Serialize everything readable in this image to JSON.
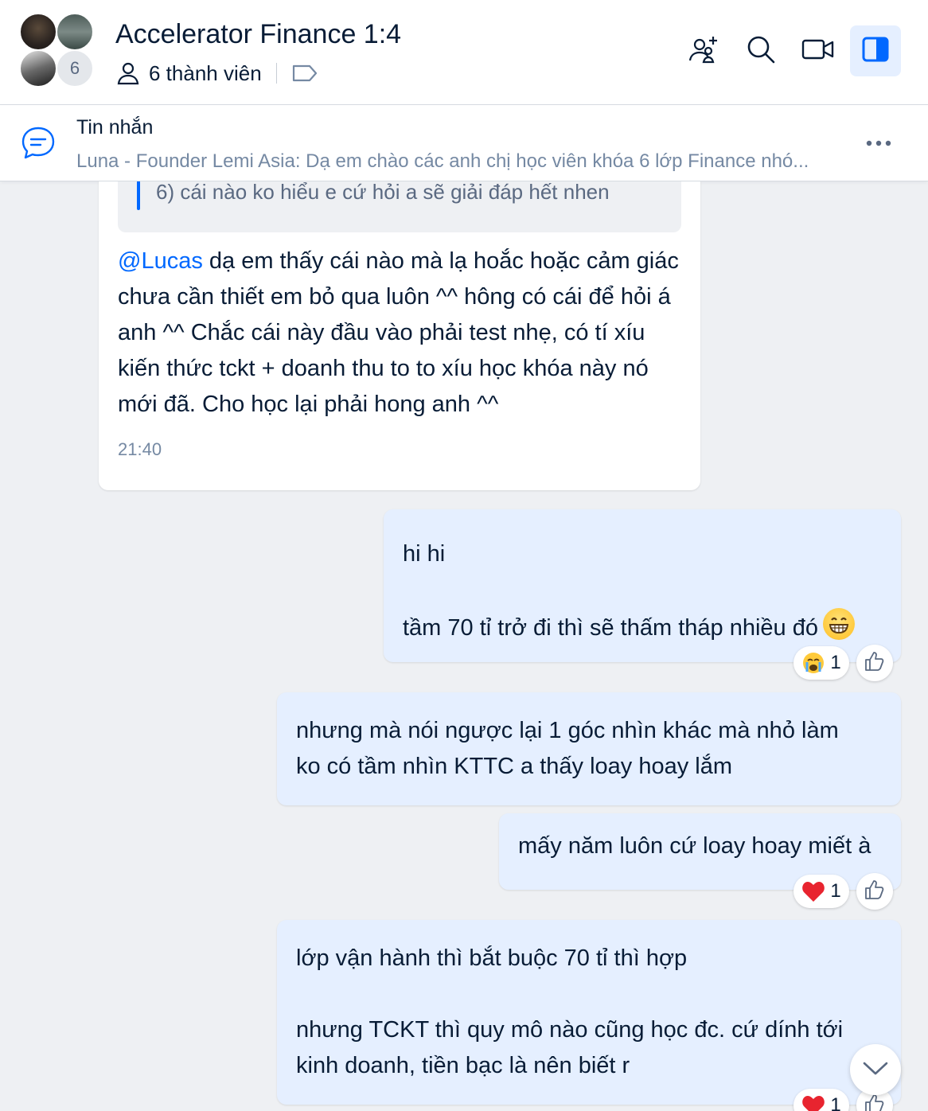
{
  "header": {
    "title": "Accelerator Finance 1:4",
    "members_count_badge": "6",
    "members_label": "6 thành viên",
    "icons": [
      "add-member-icon",
      "search-icon",
      "video-call-icon",
      "sidebar-toggle-icon",
      "tag-icon",
      "person-icon"
    ],
    "accent": "#0068ff"
  },
  "pinned": {
    "label": "Tin nhắn",
    "preview": "Luna - Founder Lemi Asia: Dạ em chào các anh chị học viên khóa 6 lớp Finance nhó..."
  },
  "messages": {
    "incoming": {
      "quote": "6) cái nào ko hiểu e cứ hỏi a sẽ giải đáp hết nhen",
      "mention": "@Lucas",
      "text": " dạ em thấy cái nào mà lạ hoắc hoặc cảm giác chưa cần thiết em bỏ qua luôn ^^ hông có cái để hỏi á anh ^^ Chắc cái này đầu vào phải test nhẹ, có tí xíu kiến thức tckt + doanh thu to to xíu học khóa này nó mới đã. Cho học lại phải hong anh ^^",
      "time": "21:40"
    },
    "out1": {
      "line1": "hi hi",
      "line2": "tầm 70 tỉ trở đi thì sẽ thấm tháp nhiều đó",
      "reaction_emoji": "crying-face",
      "reaction_count": "1"
    },
    "out2": {
      "line1": "nhưng mà nói ngược lại 1 góc nhìn khác mà nhỏ làm",
      "line2": "ko có tầm nhìn KTTC a thấy loay hoay lắm"
    },
    "out3": {
      "text": "mấy năm luôn cứ loay hoay miết à",
      "reaction_emoji": "heart",
      "reaction_count": "1"
    },
    "out4": {
      "line1": "lớp vận hành thì bắt buộc 70 tỉ thì hợp",
      "line2": "nhưng TCKT thì quy mô nào cũng học đc. cứ dính tới",
      "line3": "kinh doanh, tiền bạc là nên biết r",
      "reaction_emoji": "heart",
      "reaction_count": "1"
    }
  }
}
